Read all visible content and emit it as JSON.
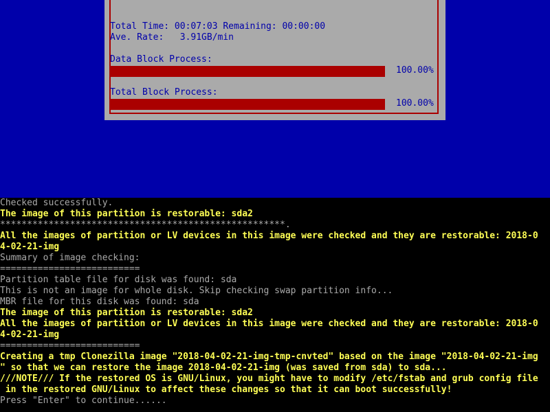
{
  "dialog": {
    "total_time_line": "Total Time: 00:07:03 Remaining: 00:00:00",
    "rate_line": "Ave. Rate:   3.91GB/min",
    "data_block_label": "Data Block Process:",
    "data_block_percent": "100.00%",
    "data_block_progress": 1.0,
    "total_block_label": "Total Block Process:",
    "total_block_percent": "100.00%",
    "total_block_progress": 1.0
  },
  "colors": {
    "background_blue": "#0000aa",
    "dialog_gray": "#aaaaaa",
    "progress_red": "#aa0000",
    "console_gray": "#aaaaaa",
    "console_yellow": "#ffff55"
  },
  "console": {
    "lines": [
      {
        "text": "Checked successfully.",
        "style": "gray"
      },
      {
        "text": "The image of this partition is restorable: sda2",
        "style": "yellow"
      },
      {
        "text": "*****************************************************.",
        "style": "gray"
      },
      {
        "text": "All the images of partition or LV devices in this image were checked and they are restorable: 2018-0",
        "style": "yellow"
      },
      {
        "text": "4-02-21-img",
        "style": "yellow"
      },
      {
        "text": "Summary of image checking:",
        "style": "gray"
      },
      {
        "text": "==========================",
        "style": "gray"
      },
      {
        "text": "Partition table file for disk was found: sda",
        "style": "gray"
      },
      {
        "text": "This is not an image for whole disk. Skip checking swap partition info...",
        "style": "gray"
      },
      {
        "text": "MBR file for this disk was found: sda",
        "style": "gray"
      },
      {
        "text": "The image of this partition is restorable: sda2",
        "style": "yellow"
      },
      {
        "text": "All the images of partition or LV devices in this image were checked and they are restorable: 2018-0",
        "style": "yellow"
      },
      {
        "text": "4-02-21-img",
        "style": "yellow"
      },
      {
        "text": "==========================",
        "style": "gray"
      },
      {
        "text": "Creating a tmp Clonezilla image \"2018-04-02-21-img-tmp-cnvted\" based on the image \"2018-04-02-21-img",
        "style": "yellow"
      },
      {
        "text": "\" so that we can restore the image 2018-04-02-21-img (was saved from sda) to sda...",
        "style": "yellow"
      },
      {
        "text": "///NOTE/// If the restored OS is GNU/Linux, you might have to modify /etc/fstab and grub config file",
        "style": "yellow"
      },
      {
        "text": " in the restored GNU/Linux to affect these changes so that it can boot successfully!",
        "style": "yellow"
      },
      {
        "text": "Press \"Enter\" to continue......",
        "style": "gray"
      }
    ]
  }
}
